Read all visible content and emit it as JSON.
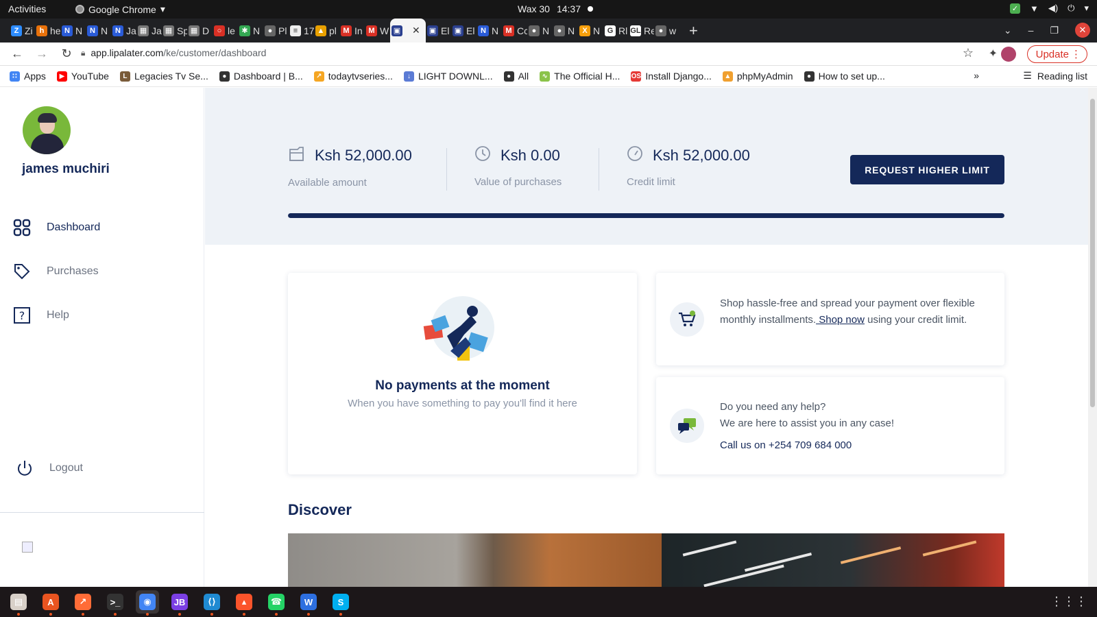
{
  "system": {
    "activities": "Activities",
    "app_name": "Google Chrome",
    "date": "Wax 30",
    "time": "14:37"
  },
  "tabs": [
    {
      "letter": "Zi",
      "color": "#2d8cff",
      "glyph": "Z"
    },
    {
      "letter": "hе",
      "color": "#e8710a",
      "glyph": "h"
    },
    {
      "letter": "N",
      "color": "#2a5bd7",
      "glyph": "N"
    },
    {
      "letter": "N",
      "color": "#2a5bd7",
      "glyph": "N"
    },
    {
      "letter": "Ja",
      "color": "#2a5bd7",
      "glyph": "N"
    },
    {
      "letter": "Ja",
      "color": "#777",
      "glyph": "▦"
    },
    {
      "letter": "Sp",
      "color": "#777",
      "glyph": "▦"
    },
    {
      "letter": "D",
      "color": "#777",
      "glyph": "▦"
    },
    {
      "letter": "le",
      "color": "#d93025",
      "glyph": "○"
    },
    {
      "letter": "N",
      "color": "#34a853",
      "glyph": "✱"
    },
    {
      "letter": "Pl",
      "color": "#666",
      "glyph": "●"
    },
    {
      "letter": "17",
      "color": "#eee",
      "glyph": "≡"
    },
    {
      "letter": "pl",
      "color": "#e8a000",
      "glyph": "▲"
    },
    {
      "letter": "In",
      "color": "#d93025",
      "glyph": "M"
    },
    {
      "letter": "W",
      "color": "#d93025",
      "glyph": "M"
    },
    {
      "letter": "",
      "color": "#2a3f8f",
      "glyph": "▣",
      "active": true
    },
    {
      "letter": "El",
      "color": "#2a3f8f",
      "glyph": "▣"
    },
    {
      "letter": "El",
      "color": "#2a3f8f",
      "glyph": "▣"
    },
    {
      "letter": "N",
      "color": "#2a5bd7",
      "glyph": "N"
    },
    {
      "letter": "Cc",
      "color": "#d93025",
      "glyph": "M"
    },
    {
      "letter": "N",
      "color": "#666",
      "glyph": "●"
    },
    {
      "letter": "N",
      "color": "#666",
      "glyph": "●"
    },
    {
      "letter": "N",
      "color": "#f59e0b",
      "glyph": "X"
    },
    {
      "letter": "Rl",
      "color": "#fff",
      "glyph": "G"
    },
    {
      "letter": "Re",
      "color": "#fff",
      "glyph": "GL"
    },
    {
      "letter": "w",
      "color": "#666",
      "glyph": "●"
    }
  ],
  "address": {
    "host": "app.lipalater.com",
    "path": "/ke/customer/dashboard",
    "update_label": "Update"
  },
  "bookmarks": {
    "items": [
      {
        "label": "Apps",
        "color": "#4285f4",
        "glyph": "∷"
      },
      {
        "label": "YouTube",
        "color": "#ff0000",
        "glyph": "▶"
      },
      {
        "label": "Legacies Tv Se...",
        "color": "#7a5c3a",
        "glyph": "L"
      },
      {
        "label": "Dashboard | B...",
        "color": "#333",
        "glyph": "●"
      },
      {
        "label": "todaytvseries...",
        "color": "#f5a623",
        "glyph": "↗"
      },
      {
        "label": "LIGHT DOWNL...",
        "color": "#5b7bd5",
        "glyph": "↓"
      },
      {
        "label": "All",
        "color": "#333",
        "glyph": "●"
      },
      {
        "label": "The Official H...",
        "color": "#8bc34a",
        "glyph": "∿"
      },
      {
        "label": "Install Django...",
        "color": "#e53935",
        "glyph": "OS"
      },
      {
        "label": "phpMyAdmin",
        "color": "#f0a030",
        "glyph": "▲"
      },
      {
        "label": "How to set up...",
        "color": "#333",
        "glyph": "●"
      }
    ],
    "reading_list": "Reading list"
  },
  "sidebar": {
    "username": "james muchiri",
    "nav": [
      {
        "label": "Dashboard",
        "icon": "grid-icon"
      },
      {
        "label": "Purchases",
        "icon": "tag-icon"
      },
      {
        "label": "Help",
        "icon": "help-icon"
      }
    ],
    "logout": "Logout"
  },
  "stats": [
    {
      "amount": "Ksh 52,000.00",
      "label": "Available amount",
      "icon": "wallet-icon"
    },
    {
      "amount": "Ksh 0.00",
      "label": "Value of purchases",
      "icon": "clock-icon"
    },
    {
      "amount": "Ksh 52,000.00",
      "label": "Credit limit",
      "icon": "gauge-icon"
    }
  ],
  "request_button": "REQUEST HIGHER LIMIT",
  "credit_progress_fraction": 1.0,
  "empty_state": {
    "title": "No payments at the moment",
    "subtitle": "When you have something to pay you'll find it here"
  },
  "shop_card": {
    "text_before": "Shop hassle-free and spread your payment over flexible monthly installments.",
    "link": " Shop now",
    "text_after": " using your credit limit."
  },
  "help_card": {
    "line1": "Do you need any help?",
    "line2": "We are here to assist you in any case!",
    "call": "Call us on +254 709 684 000"
  },
  "discover_title": "Discover",
  "colors": {
    "brand_navy": "#142859",
    "muted_text": "#8a94a6",
    "band_bg": "#eef2f7",
    "accent_green": "#79b83a"
  },
  "dock": [
    {
      "name": "files-icon",
      "color": "#d8d0c8",
      "glyph": "▤"
    },
    {
      "name": "software-icon",
      "color": "#e95420",
      "glyph": "A"
    },
    {
      "name": "postman-icon",
      "color": "#ff6c37",
      "glyph": "↗"
    },
    {
      "name": "terminal-icon",
      "color": "#333",
      "glyph": ">_"
    },
    {
      "name": "chrome-icon",
      "color": "#4285f4",
      "glyph": "◉",
      "active": true
    },
    {
      "name": "jetbrains-icon",
      "color": "#7b3fe4",
      "glyph": "JB"
    },
    {
      "name": "vscode-icon",
      "color": "#1f8ad2",
      "glyph": "⟨⟩"
    },
    {
      "name": "brave-icon",
      "color": "#fb542b",
      "glyph": "▴"
    },
    {
      "name": "whatsapp-icon",
      "color": "#25d366",
      "glyph": "☎"
    },
    {
      "name": "wps-icon",
      "color": "#2d6fe0",
      "glyph": "W"
    },
    {
      "name": "skype-icon",
      "color": "#00aff0",
      "glyph": "S"
    }
  ]
}
